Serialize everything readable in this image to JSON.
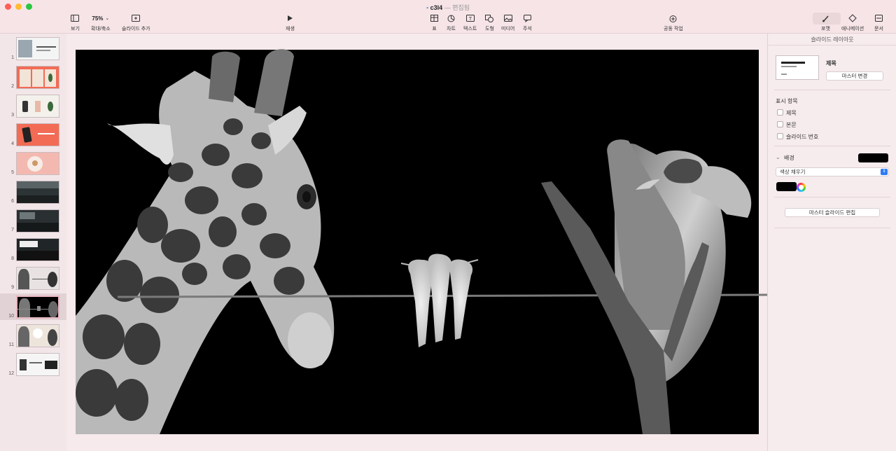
{
  "window": {
    "title": "c3l4",
    "separator": "—",
    "status": "편집됨"
  },
  "toolbar": {
    "view": "보기",
    "zoom_value": "75%",
    "zoom": "확대/축소",
    "add_slide": "슬라이드 추가",
    "play": "재생",
    "table": "표",
    "chart": "차트",
    "text": "텍스트",
    "shape": "도형",
    "media": "미디어",
    "comment": "주석",
    "collaborate": "공동 작업",
    "format": "포맷",
    "animate": "애니메이션",
    "document": "문서"
  },
  "slides": [
    {
      "num": "1"
    },
    {
      "num": "2"
    },
    {
      "num": "3"
    },
    {
      "num": "4"
    },
    {
      "num": "5"
    },
    {
      "num": "6"
    },
    {
      "num": "7"
    },
    {
      "num": "8"
    },
    {
      "num": "9"
    },
    {
      "num": "10",
      "selected": true
    },
    {
      "num": "11"
    },
    {
      "num": "12"
    }
  ],
  "inspector": {
    "header": "슬라이드 레이아웃",
    "layout_name": "제목",
    "change_master": "마스터 변경",
    "display_heading": "표시 항목",
    "opt_title": "제목",
    "opt_body": "본문",
    "opt_slide_number": "슬라이드 번호",
    "background_heading": "배경",
    "fill_type": "색상 채우기",
    "edit_master": "마스터 슬라이드 편집",
    "background_color": "#000000"
  },
  "colors": {
    "accent": "#2d7cf6",
    "close": "#ff5f57",
    "minimize": "#febc2e",
    "zoom": "#28c840"
  }
}
